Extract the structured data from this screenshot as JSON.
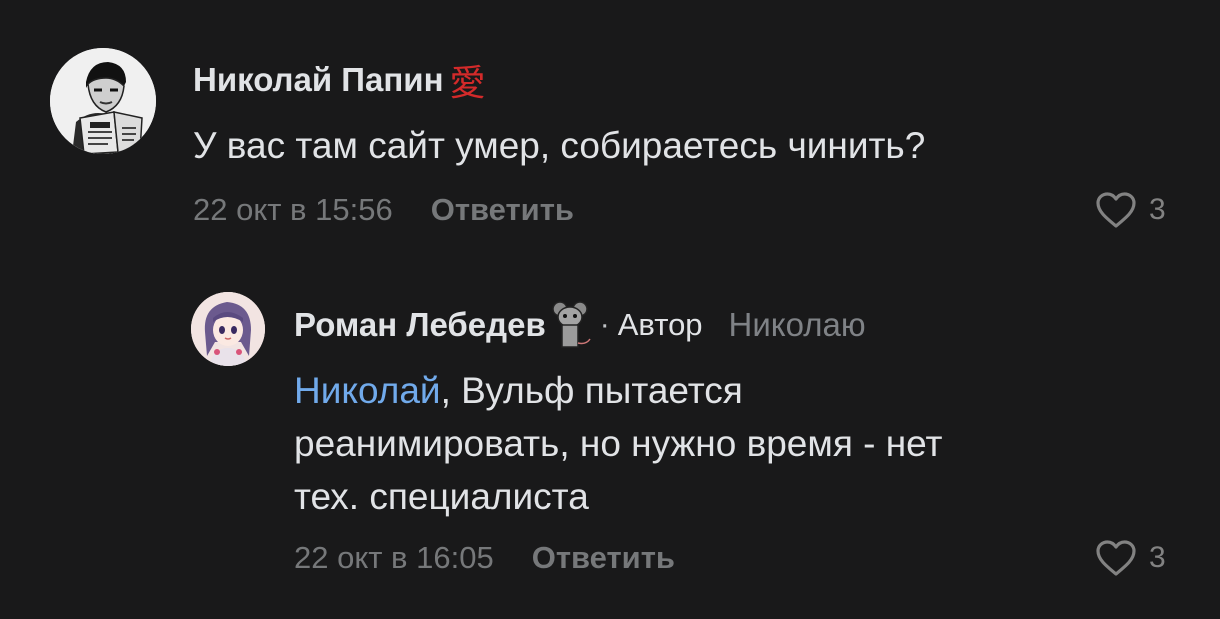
{
  "comments": [
    {
      "author": "Николай Папин",
      "author_emoji": "愛",
      "text": "У вас там сайт умер, собираетесь чинить?",
      "date": "22 окт в 15:56",
      "reply_label": "Ответить",
      "likes": "3"
    },
    {
      "author": "Роман Лебедев",
      "role_sep": "·",
      "role": "Автор",
      "reply_to": "Николаю",
      "mention": "Николай",
      "text_after_mention": ", Вульф пытается",
      "text_line2": "реанимировать, но нужно время - нет",
      "text_line3": "тех. специалиста",
      "date": "22 окт в 16:05",
      "reply_label": "Ответить",
      "likes": "3"
    }
  ],
  "colors": {
    "background": "#19191a",
    "text_primary": "#e1e3e6",
    "text_secondary": "#76787a",
    "link": "#71aaeb",
    "emoji_red": "#d32a2a"
  },
  "icons": {
    "like": "heart-outline-icon",
    "author_badge": "mouse-sticker-icon"
  }
}
